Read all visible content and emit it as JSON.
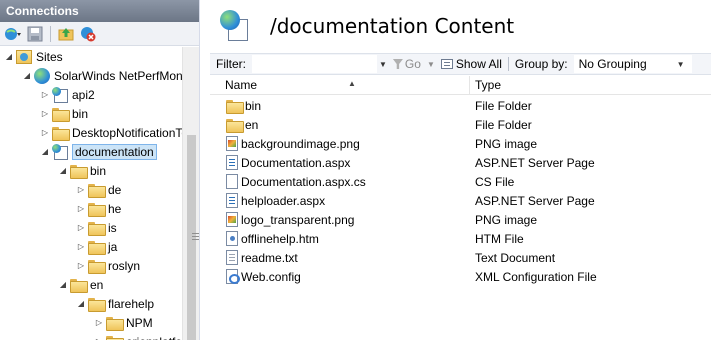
{
  "connections": {
    "header": "Connections",
    "toolbar": [
      "connect-icon",
      "save-icon",
      "up-icon",
      "disconnect-icon"
    ],
    "tree": [
      {
        "label": "Sites",
        "depth": 0,
        "icon": "sites-icon",
        "expander": "expanded"
      },
      {
        "label": "SolarWinds NetPerfMon",
        "depth": 1,
        "icon": "globe-icon",
        "expander": "expanded"
      },
      {
        "label": "api2",
        "depth": 2,
        "icon": "app-icon",
        "expander": "collapsed"
      },
      {
        "label": "bin",
        "depth": 2,
        "icon": "folder-icon",
        "expander": "collapsed"
      },
      {
        "label": "DesktopNotificationTo",
        "depth": 2,
        "icon": "folder-icon",
        "expander": "collapsed"
      },
      {
        "label": "documentation",
        "depth": 2,
        "icon": "app-icon",
        "expander": "expanded",
        "selected": true
      },
      {
        "label": "bin",
        "depth": 3,
        "icon": "folder-icon",
        "expander": "expanded"
      },
      {
        "label": "de",
        "depth": 4,
        "icon": "folder-icon",
        "expander": "collapsed"
      },
      {
        "label": "he",
        "depth": 4,
        "icon": "folder-icon",
        "expander": "collapsed"
      },
      {
        "label": "is",
        "depth": 4,
        "icon": "folder-icon",
        "expander": "collapsed"
      },
      {
        "label": "ja",
        "depth": 4,
        "icon": "folder-icon",
        "expander": "collapsed"
      },
      {
        "label": "roslyn",
        "depth": 4,
        "icon": "folder-icon",
        "expander": "collapsed"
      },
      {
        "label": "en",
        "depth": 3,
        "icon": "folder-icon",
        "expander": "expanded"
      },
      {
        "label": "flarehelp",
        "depth": 4,
        "icon": "folder-icon",
        "expander": "expanded"
      },
      {
        "label": "NPM",
        "depth": 5,
        "icon": "folder-icon",
        "expander": "collapsed"
      },
      {
        "label": "orionplatfo",
        "depth": 5,
        "icon": "folder-icon",
        "expander": "collapsed"
      }
    ]
  },
  "content": {
    "title": "/documentation Content",
    "filter": {
      "label": "Filter:",
      "value": "",
      "go_label": "Go",
      "show_all_label": "Show All",
      "group_by_label": "Group by:",
      "group_by_value": "No Grouping"
    },
    "columns": {
      "name": "Name",
      "type": "Type"
    },
    "items": [
      {
        "name": "bin",
        "type": "File Folder",
        "icon": "folder"
      },
      {
        "name": "en",
        "type": "File Folder",
        "icon": "folder"
      },
      {
        "name": "backgroundimage.png",
        "type": "PNG image",
        "icon": "png"
      },
      {
        "name": "Documentation.aspx",
        "type": "ASP.NET Server Page",
        "icon": "aspx"
      },
      {
        "name": "Documentation.aspx.cs",
        "type": "CS File",
        "icon": "cs"
      },
      {
        "name": "helploader.aspx",
        "type": "ASP.NET Server Page",
        "icon": "aspx"
      },
      {
        "name": "logo_transparent.png",
        "type": "PNG image",
        "icon": "png"
      },
      {
        "name": "offlinehelp.htm",
        "type": "HTM File",
        "icon": "htm"
      },
      {
        "name": "readme.txt",
        "type": "Text Document",
        "icon": "txt"
      },
      {
        "name": "Web.config",
        "type": "XML Configuration File",
        "icon": "config"
      }
    ]
  }
}
